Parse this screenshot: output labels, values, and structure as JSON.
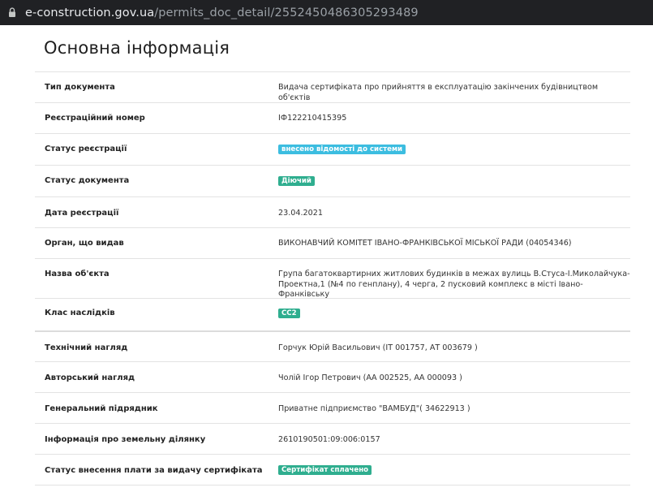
{
  "browser": {
    "url_domain": "e-construction.gov.ua",
    "url_path": "/permits_doc_detail/2552450486305293489"
  },
  "page": {
    "title": "Основна інформація"
  },
  "rows": [
    {
      "label": "Тип документа",
      "value": "Видача сертифіката про прийняття в експлуатацію закінчених будівництвом об'єктів"
    },
    {
      "label": "Реєстраційний номер",
      "value": "ІФ122210415395"
    },
    {
      "label": "Статус реєстрації",
      "badge": "внесено відомості до системи",
      "badge_color": "#3cbde0"
    },
    {
      "label": "Статус документа",
      "badge": "Діючий",
      "badge_color": "#2fae8f"
    },
    {
      "label": "Дата реєстрації",
      "value": "23.04.2021"
    },
    {
      "label": "Орган, що видав",
      "value": "ВИКОНАВЧИЙ КОМІТЕТ ІВАНО-ФРАНКІВСЬКОЇ МІСЬКОЇ РАДИ (04054346)"
    },
    {
      "label": "Назва об'єкта",
      "value": "Група багатоквартирних житлових будинків в межах вулиць В.Стуса-І.Миколайчука-Проектна,1 (№4 по генплану), 4 черга, 2 пусковий комплекс в місті Івано-Франківську"
    },
    {
      "label": "Клас наслідків",
      "badge": "СС2",
      "badge_color": "#2fae8f"
    },
    {
      "label": "Технічний нагляд",
      "value": "Горчук Юрій Васильович (ІТ 001757, АТ 003679 )"
    },
    {
      "label": "Авторський нагляд",
      "value": "Чолій Ігор Петрович (АА 002525, АА 000093 )"
    },
    {
      "label": "Генеральний підрядник",
      "value": "Приватне підприємство \"ВАМБУД\"( 34622913 )"
    },
    {
      "label": "Інформація про земельну ділянку",
      "value": "2610190501:09:006:0157"
    },
    {
      "label": "Статус внесення плати за видачу сертифіката",
      "badge": "Сертифікат сплачено",
      "badge_color": "#2fae8f"
    }
  ],
  "colors": {
    "badge_blue": "#3cbde0",
    "badge_green": "#2fae8f"
  }
}
